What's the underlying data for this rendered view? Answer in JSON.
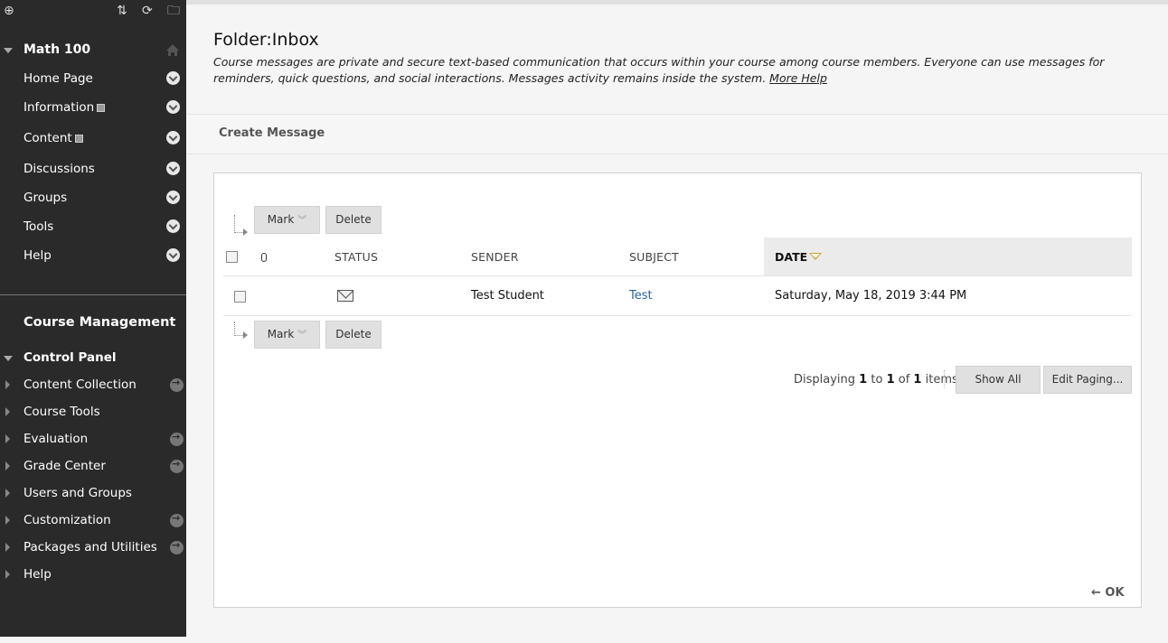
{
  "sidebar": {
    "toolbar": {
      "add_icon": "⊕",
      "sort_icon": "⇅",
      "refresh_icon": "⟳",
      "folder_icon": "🗀"
    },
    "course_title": "Math 100",
    "menu_items": [
      {
        "label": "Home Page"
      },
      {
        "label": "Information"
      },
      {
        "label": "Content"
      },
      {
        "label": "Discussions"
      },
      {
        "label": "Groups"
      },
      {
        "label": "Tools"
      },
      {
        "label": "Help"
      }
    ],
    "course_management_title": "Course Management",
    "control_panel_title": "Control Panel",
    "control_panel_items": [
      {
        "label": "Content Collection"
      },
      {
        "label": "Course Tools"
      },
      {
        "label": "Evaluation"
      },
      {
        "label": "Grade Center"
      },
      {
        "label": "Users and Groups"
      },
      {
        "label": "Customization"
      },
      {
        "label": "Packages and Utilities"
      },
      {
        "label": "Help"
      }
    ]
  },
  "main": {
    "page_title": "Folder:Inbox",
    "description": "Course messages are private and secure text-based communication that occurs within your course among course members. Everyone can use messages for reminders, quick questions, and social interactions. Messages activity remains inside the system.",
    "more_help_link": "More Help",
    "create_message_label": "Create Message",
    "mark_label": "Mark",
    "delete_label": "Delete",
    "table": {
      "headers": {
        "status": "STATUS",
        "sender": "SENDER",
        "subject": "SUBJECT",
        "date": "DATE"
      },
      "rows": [
        {
          "sender": "Test Student",
          "subject": "Test",
          "date": "Saturday, May 18, 2019 3:44 PM"
        }
      ]
    },
    "paging": {
      "prefix": "Displaying",
      "from": "1",
      "to_word": "to",
      "to": "1",
      "of_word": "of",
      "total": "1",
      "suffix": "items",
      "show_all_label": "Show All",
      "edit_paging_label": "Edit Paging..."
    },
    "ok_label": "← OK"
  }
}
